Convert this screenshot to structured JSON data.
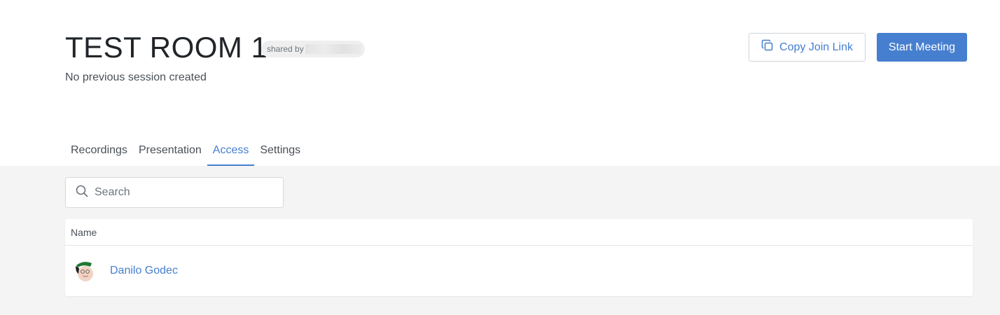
{
  "header": {
    "title": "TEST ROOM 1",
    "shared_by_label": "shared by",
    "subtitle": "No previous session created",
    "copy_join_link_label": "Copy Join Link",
    "start_meeting_label": "Start Meeting"
  },
  "tabs": [
    {
      "label": "Recordings",
      "active": false
    },
    {
      "label": "Presentation",
      "active": false
    },
    {
      "label": "Access",
      "active": true
    },
    {
      "label": "Settings",
      "active": false
    }
  ],
  "access": {
    "search_placeholder": "Search",
    "table": {
      "column_header": "Name",
      "rows": [
        {
          "name": "Danilo Godec",
          "avatar": "cartoon-avatar"
        }
      ]
    }
  },
  "colors": {
    "accent": "#467fcf",
    "panel_background": "#f4f4f4"
  },
  "icons": {
    "copy": "copy-icon",
    "search": "search-icon"
  }
}
